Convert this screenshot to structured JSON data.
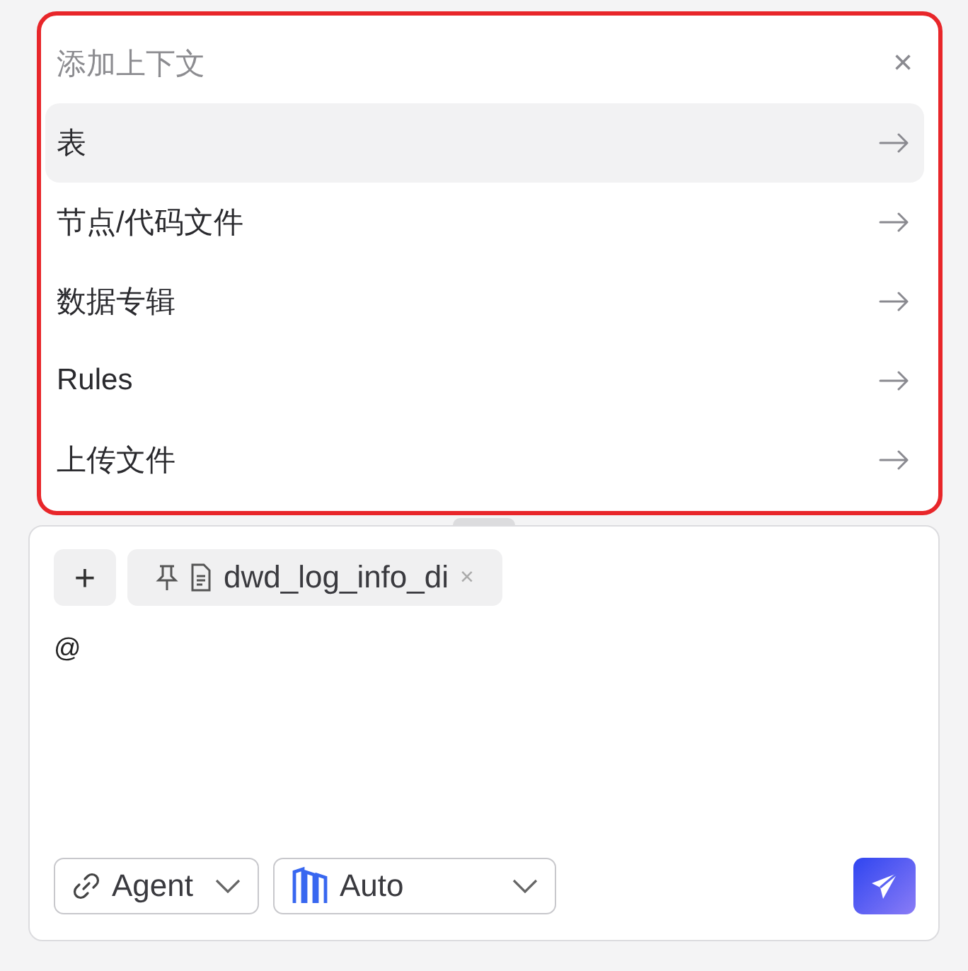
{
  "context_menu": {
    "title": "添加上下文",
    "close": "×",
    "items": [
      {
        "label": "表",
        "selected": true
      },
      {
        "label": "节点/代码文件",
        "selected": false
      },
      {
        "label": "数据专辑",
        "selected": false
      },
      {
        "label": "Rules",
        "selected": false
      },
      {
        "label": "上传文件",
        "selected": false
      }
    ]
  },
  "composer": {
    "add_button": "+",
    "context_chip": {
      "label": "dwd_log_info_di",
      "remove": "×"
    },
    "input": {
      "value": "@"
    },
    "mode_select": {
      "value": "Agent"
    },
    "model_select": {
      "value": "Auto"
    }
  }
}
